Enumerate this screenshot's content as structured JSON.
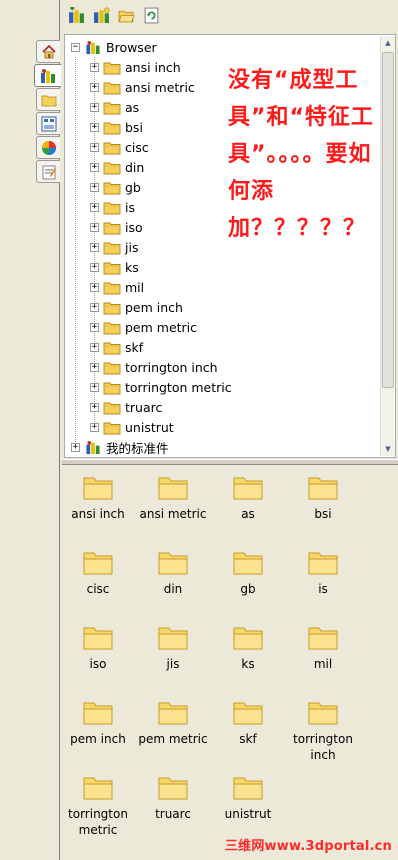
{
  "overlay_question": "没有“成型工具”和“特征工具”。。。。要如何添加？？？？？",
  "tree": {
    "root_label": "Browser",
    "items": [
      "ansi inch",
      "ansi metric",
      "as",
      "bsi",
      "cisc",
      "din",
      "gb",
      "is",
      "iso",
      "jis",
      "ks",
      "mil",
      "pem inch",
      "pem metric",
      "skf",
      "torrington inch",
      "torrington metric",
      "truarc",
      "unistrut"
    ],
    "bottom_label": "我的标准件"
  },
  "icons": [
    "ansi inch",
    "ansi metric",
    "as",
    "bsi",
    "cisc",
    "din",
    "gb",
    "is",
    "iso",
    "jis",
    "ks",
    "mil",
    "pem inch",
    "pem metric",
    "skf",
    "torrington inch",
    "torrington metric",
    "truarc",
    "unistrut"
  ],
  "watermark": "三维网www.3dportal.cn",
  "colors": {
    "accent_red": "#ff1a1a",
    "folder": "#f6cf57",
    "panel": "#ece9d8"
  },
  "side_tabs": [
    "home-icon",
    "design-library-icon",
    "file-explorer-icon",
    "view-palette-icon",
    "appearances-icon",
    "custom-properties-icon"
  ],
  "toolbar_icons": [
    "add-library-icon",
    "create-folder-icon",
    "open-folder-icon",
    "refresh-icon"
  ]
}
